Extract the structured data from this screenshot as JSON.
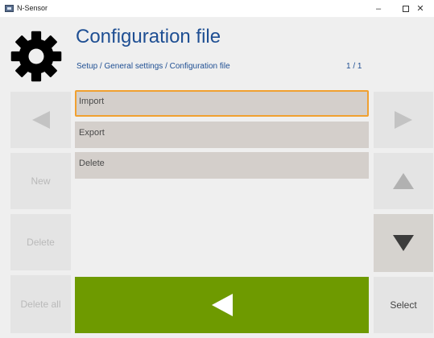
{
  "window": {
    "title": "N-Sensor"
  },
  "header": {
    "title": "Configuration file",
    "breadcrumb": "Setup / General settings / Configuration file",
    "page_indicator": "1 / 1"
  },
  "left_buttons": {
    "new": "New",
    "delete": "Delete",
    "delete_all": "Delete all"
  },
  "right_buttons": {
    "select": "Select"
  },
  "list": {
    "items": [
      "Import",
      "Export",
      "Delete"
    ],
    "selected_index": 0
  },
  "colors": {
    "title_blue": "#1f4f93",
    "accent_orange": "#f0a030",
    "action_green": "#6e9a00",
    "list_item_bg": "#d4cfcb"
  },
  "icons": {
    "logo": "gear-icon",
    "prev": "triangle-left-icon",
    "next": "triangle-right-icon",
    "up": "triangle-up-icon",
    "down": "triangle-down-icon",
    "back": "back-arrow-icon"
  }
}
